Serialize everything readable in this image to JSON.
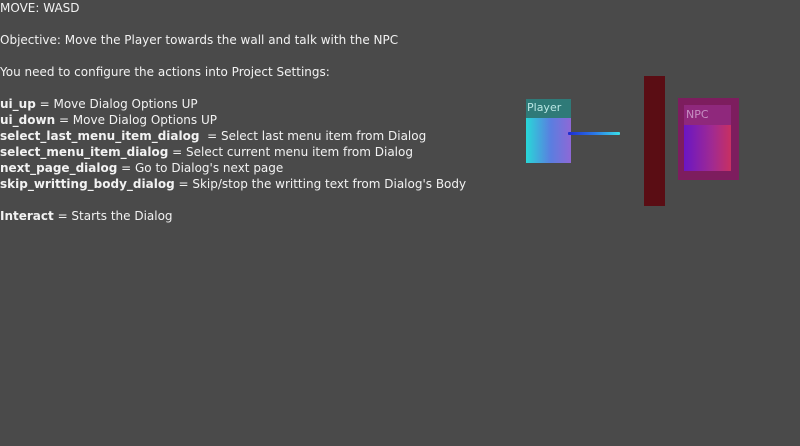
{
  "hud": {
    "move_line": "MOVE: WASD",
    "objective": "Objective: Move the Player towards the wall and talk with the NPC",
    "config_note": "You need to configure the actions into Project Settings:",
    "actions": [
      {
        "name": "ui_up",
        "desc": " = Move Dialog Options UP"
      },
      {
        "name": "ui_down",
        "desc": " = Move Dialog Options UP"
      },
      {
        "name": "select_last_menu_item_dialog",
        "desc": "  = Select last menu item from Dialog"
      },
      {
        "name": "select_menu_item_dialog",
        "desc": " = Select current menu item from Dialog"
      },
      {
        "name": "next_page_dialog",
        "desc": " = Go to Dialog's next page"
      },
      {
        "name": "skip_writting_body_dialog",
        "desc": " = Skip/stop the writting text from Dialog's Body"
      }
    ],
    "interact": {
      "name": "Interact",
      "desc": " = Starts the Dialog"
    }
  },
  "scene": {
    "player": {
      "label": "Player",
      "color": "#28d8d8"
    },
    "npc": {
      "label": "NPC",
      "color": "#a02a92"
    },
    "wall": {
      "color": "#5a0d14"
    }
  }
}
